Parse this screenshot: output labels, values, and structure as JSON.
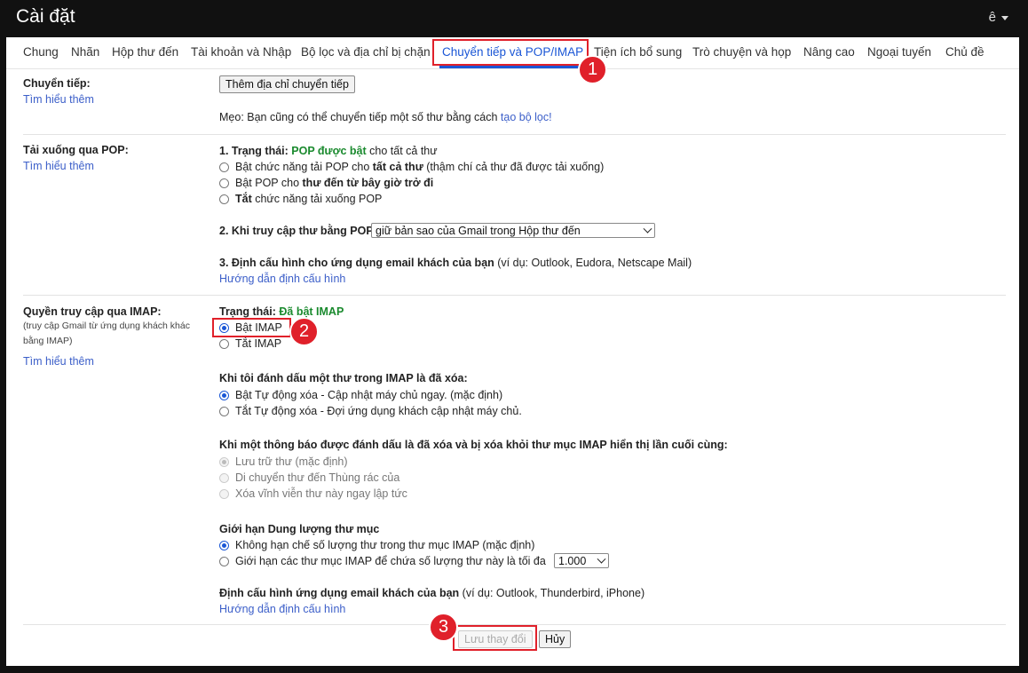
{
  "header": {
    "title": "Cài đặt",
    "account": "ê"
  },
  "tabs": [
    {
      "label": "Chung"
    },
    {
      "label": "Nhãn"
    },
    {
      "label": "Hộp thư đến"
    },
    {
      "label": "Tài khoản và Nhập"
    },
    {
      "label": "Bộ lọc và địa chỉ bị chặn"
    },
    {
      "label": "Chuyển tiếp và POP/IMAP"
    },
    {
      "label": "Tiện ích bổ sung"
    },
    {
      "label": "Trò chuyện và họp"
    },
    {
      "label": "Nâng cao"
    },
    {
      "label": "Ngoại tuyến"
    },
    {
      "label": "Chủ đề"
    }
  ],
  "active_tab": "Chuyển tiếp và POP/IMAP",
  "annotations": [
    "1",
    "2",
    "3"
  ],
  "highlight_color": "#e0202a",
  "forwarding": {
    "label": "Chuyển tiếp:",
    "learn_more": "Tìm hiểu thêm",
    "add_button": "Thêm địa chỉ chuyển tiếp",
    "tip_prefix": "Mẹo: Bạn cũng có thể chuyển tiếp một số thư bằng cách ",
    "tip_link": "tạo bộ lọc!"
  },
  "pop": {
    "label": "Tải xuống qua POP:",
    "learn_more": "Tìm hiểu thêm",
    "status_label": "1. Trạng thái: ",
    "status_value": "POP được bật",
    "status_suffix": " cho tất cả thư",
    "options": [
      {
        "pre": "Bật chức năng tải POP cho ",
        "bold": "tất cả thư",
        "post": " (thậm chí cả thư đã được tải xuống)",
        "checked": false
      },
      {
        "pre": "Bật POP cho ",
        "bold": "thư đến từ bây giờ trở đi",
        "post": "",
        "checked": false
      },
      {
        "pre": "",
        "bold": "Tắt",
        "post": " chức năng tải xuống POP",
        "checked": false
      }
    ],
    "access_label": "2. Khi truy cập thư bằng POP",
    "access_select": "giữ bản sao của Gmail trong Hộp thư đến",
    "config_label": "3. Định cấu hình cho ứng dụng email khách của bạn",
    "config_example": " (ví dụ: Outlook, Eudora, Netscape Mail)",
    "config_link": "Hướng dẫn định cấu hình"
  },
  "imap": {
    "label": "Quyền truy cập qua IMAP:",
    "note": "(truy cập Gmail từ ứng dụng khách khác bằng IMAP)",
    "learn_more": "Tìm hiểu thêm",
    "status_label": "Trạng thái: ",
    "status_value": "Đã bật IMAP",
    "enable": "Bật IMAP",
    "disable": "Tắt IMAP",
    "delete_heading": "Khi tôi đánh dấu một thư trong IMAP là đã xóa:",
    "delete_options": [
      "Bật Tự động xóa - Cập nhật máy chủ ngay. (mặc định)",
      "Tắt Tự động xóa - Đợi ứng dụng khách cập nhật máy chủ."
    ],
    "expunge_heading": "Khi một thông báo được đánh dấu là đã xóa và bị xóa khỏi thư mục IMAP hiển thị lần cuối cùng:",
    "expunge_options": [
      "Lưu trữ thư (mặc định)",
      "Di chuyển thư đến Thùng rác của",
      "Xóa vĩnh viễn thư này ngay lập tức"
    ],
    "folder_heading": "Giới hạn Dung lượng thư mục",
    "folder_options": [
      "Không hạn chế số lượng thư trong thư mục IMAP (mặc định)",
      "Giới hạn các thư mục IMAP để chứa số lượng thư này là tối đa"
    ],
    "folder_limit": "1.000",
    "client_label": "Định cấu hình ứng dụng email khách của bạn",
    "client_example": " (ví dụ: Outlook, Thunderbird, iPhone)",
    "client_link": "Hướng dẫn định cấu hình"
  },
  "footer": {
    "save": "Lưu thay đổi",
    "cancel": "Hủy"
  }
}
